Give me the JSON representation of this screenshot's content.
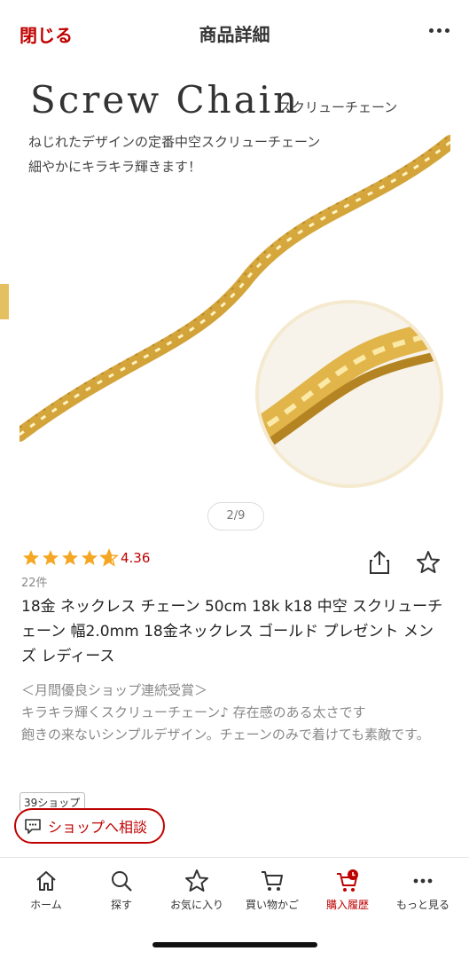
{
  "header": {
    "close_label": "閉じる",
    "title": "商品詳細"
  },
  "hero": {
    "title": "Screw Chain",
    "subtitle": "スクリューチェーン",
    "caption_line1": "ねじれたデザインの定番中空スクリューチェーン",
    "caption_line2": "細やかにキラキラ輝きます！"
  },
  "pager": {
    "text": "2/9"
  },
  "rating": {
    "value": "4.36",
    "count": "22件",
    "stars": 4.36
  },
  "product": {
    "title": "18金 ネックレス チェーン 50cm 18k k18 中空 スクリューチェーン 幅2.0mm 18金ネックレス ゴールド プレゼント メンズ レディース",
    "desc_line1": "＜月間優良ショップ連続受賞＞",
    "desc_line2": "キラキラ輝くスクリューチェーン♪ 存在感のある太さです",
    "desc_line3": "飽きの来ないシンプルデザイン。チェーンのみで着けても素敵です。"
  },
  "shop_badge": "39ショップ",
  "consult_button": "ショップへ相談",
  "nav": {
    "items": [
      {
        "label": "ホーム",
        "icon": "home-icon"
      },
      {
        "label": "探す",
        "icon": "search-icon"
      },
      {
        "label": "お気に入り",
        "icon": "star-icon"
      },
      {
        "label": "買い物かご",
        "icon": "cart-icon"
      },
      {
        "label": "購入履歴",
        "icon": "purchase-history-icon"
      },
      {
        "label": "もっと見る",
        "icon": "more-icon"
      }
    ]
  },
  "colors": {
    "accent": "#bf0000",
    "star": "#f5a623",
    "gold": "#d8ad3c"
  }
}
